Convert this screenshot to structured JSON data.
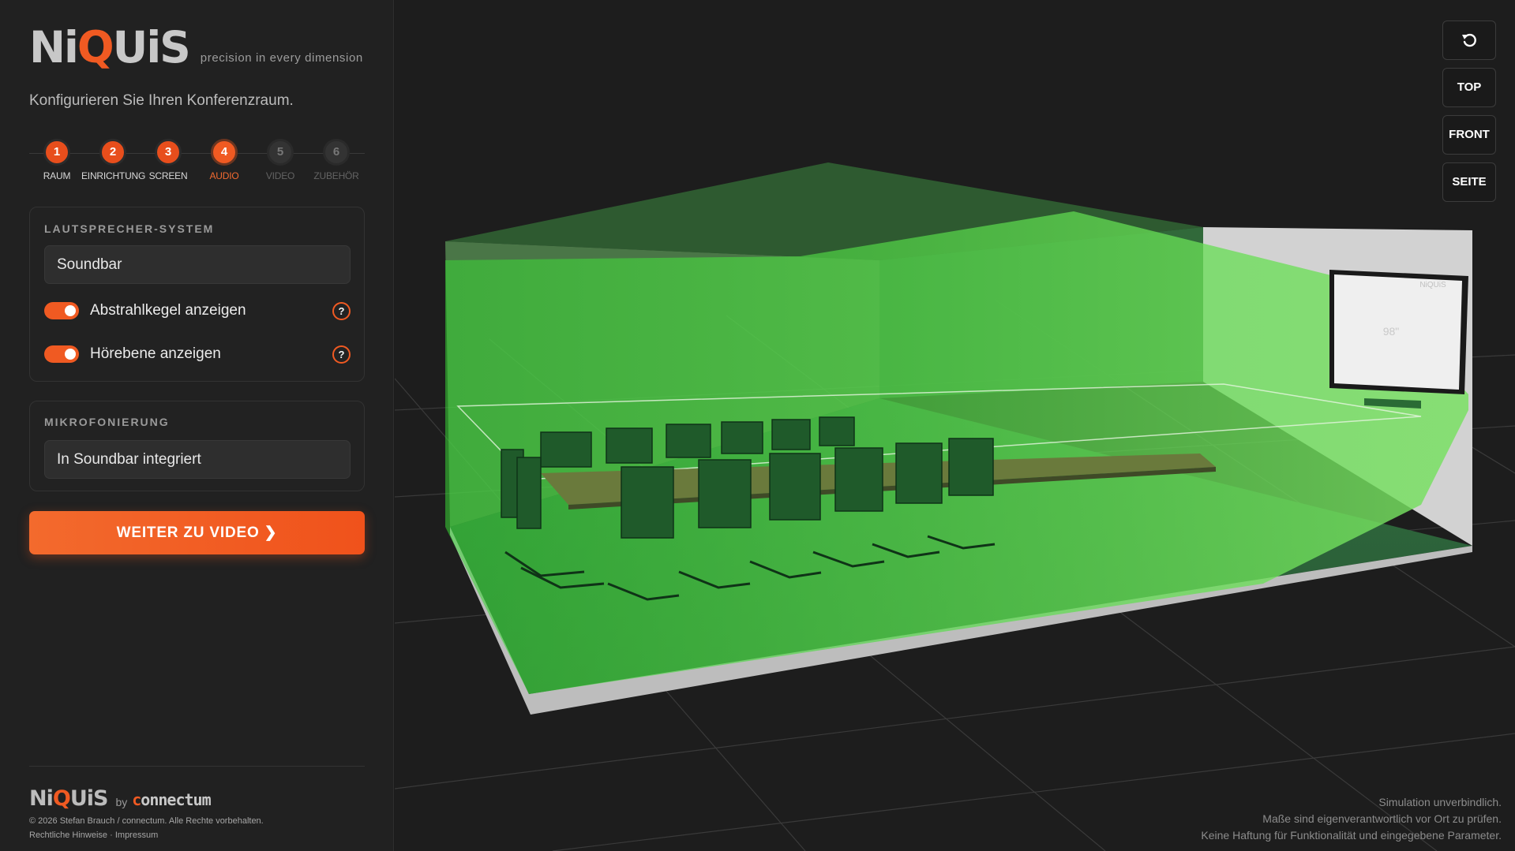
{
  "brand": {
    "logo_pre": "Ni",
    "logo_q": "Q",
    "logo_post": "UiS",
    "tagline": "precision in every dimension",
    "accent": "#f05a22"
  },
  "intro": "Konfigurieren Sie Ihren Konferenzraum.",
  "stepper": {
    "steps": [
      {
        "number": "1",
        "label": "RAUM",
        "state": "done"
      },
      {
        "number": "2",
        "label": "EINRICHTUNG",
        "state": "done"
      },
      {
        "number": "3",
        "label": "SCREEN",
        "state": "done"
      },
      {
        "number": "4",
        "label": "AUDIO",
        "state": "active"
      },
      {
        "number": "5",
        "label": "VIDEO",
        "state": "todo"
      },
      {
        "number": "6",
        "label": "ZUBEHÖR",
        "state": "todo"
      }
    ]
  },
  "speaker_card": {
    "title": "LAUTSPRECHER-SYSTEM",
    "select_value": "Soundbar",
    "toggles": [
      {
        "label": "Abstrahlkegel anzeigen",
        "on": true,
        "help": "?"
      },
      {
        "label": "Hörebene anzeigen",
        "on": true,
        "help": "?"
      }
    ]
  },
  "mic_card": {
    "title": "MIKROFONIERUNG",
    "select_value": "In Soundbar integriert"
  },
  "cta_label": "WEITER ZU VIDEO ❯",
  "footer": {
    "logo_pre": "Ni",
    "logo_q": "Q",
    "logo_post": "UiS",
    "by": "by",
    "partner_c": "c",
    "partner_rest": "onnectum",
    "copyright": "© 2026 Stefan Brauch / connectum. Alle Rechte vorbehalten.",
    "legal_link": "Rechtliche Hinweise",
    "separator": "·",
    "imprint_link": "Impressum"
  },
  "viewport": {
    "view_buttons": {
      "reset_icon": "rotate-left-icon",
      "top": "TOP",
      "front": "FRONT",
      "side": "SEITE"
    },
    "display_brand": "NiQUiS",
    "display_size": "98\"",
    "disclaimer": [
      "Simulation unverbindlich.",
      "Maße sind eigenverantwortlich vor Ort zu prüfen.",
      "Keine Haftung für Funktionalität und eingegebene Parameter."
    ],
    "colors": {
      "cone": "#3fd03a",
      "floor": "#2f6a3c",
      "wall": "#d6d6d6",
      "grid": "#3a3a3a"
    }
  }
}
